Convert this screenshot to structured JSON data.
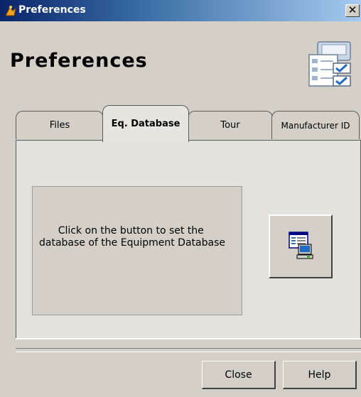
{
  "window": {
    "title": "Preferences",
    "close_glyph": "✕",
    "title_icon": "app-logo-icon"
  },
  "heading": {
    "text": "Preferences",
    "icon": "preferences-checklist-icon"
  },
  "tabs": [
    {
      "label": "Files",
      "active": false
    },
    {
      "label": "Eq. Database",
      "active": true
    },
    {
      "label": "Tour",
      "active": false
    },
    {
      "label": "Manufacturer ID",
      "active": false
    }
  ],
  "panel": {
    "info_text": "      Click on the button to set the database of the Equipment Database",
    "button_icon": "database-computer-icon"
  },
  "buttons": {
    "close": "Close",
    "help": "Help"
  },
  "colors": {
    "window_bg": "#d4d0c8",
    "titlebar_start": "#0a246a",
    "titlebar_end": "#a6caf0",
    "active_tab_bg": "#e7e5e0"
  }
}
